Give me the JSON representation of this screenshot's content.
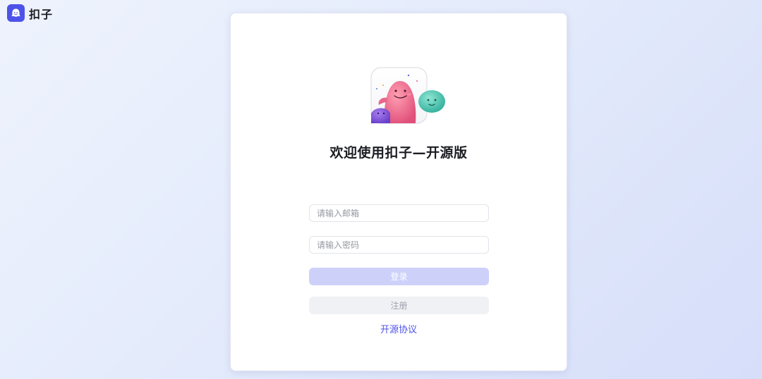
{
  "brand": {
    "name": "扣子",
    "accent": "#4d53e8"
  },
  "login": {
    "welcome_title": "欢迎使用扣子—开源版",
    "email_placeholder": "请输入邮箱",
    "password_placeholder": "请输入密码",
    "login_label": "登录",
    "register_label": "注册",
    "protocol_link": "开源协议"
  },
  "icons": {
    "brand": "ghost-logo-icon",
    "mascot": "mascot-illustration"
  }
}
